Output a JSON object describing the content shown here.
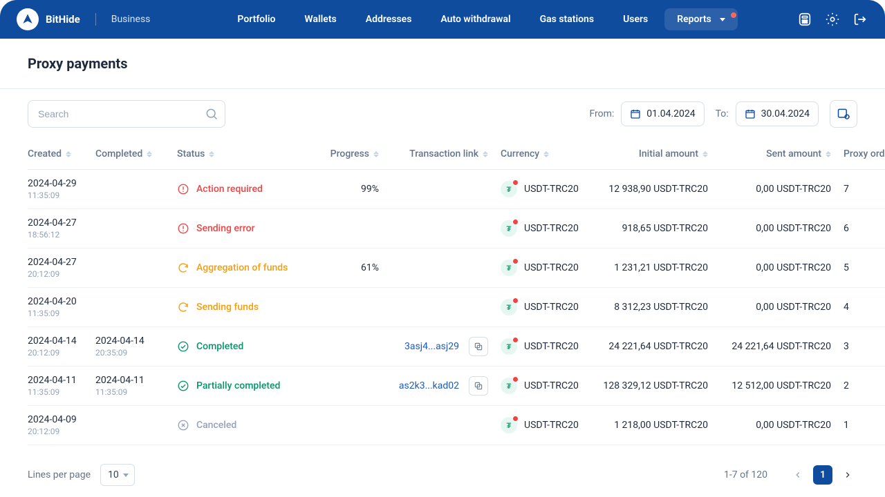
{
  "brand": {
    "name": "BitHide",
    "sub": "Business"
  },
  "nav": {
    "items": [
      "Portfolio",
      "Wallets",
      "Addresses",
      "Auto withdrawal",
      "Gas stations",
      "Users",
      "Reports"
    ],
    "active_index": 6
  },
  "page": {
    "title": "Proxy payments"
  },
  "toolbar": {
    "search_placeholder": "Search",
    "from_label": "From:",
    "to_label": "To:",
    "from_date": "01.04.2024",
    "to_date": "30.04.2024"
  },
  "columns": {
    "created": "Created",
    "completed": "Completed",
    "status": "Status",
    "progress": "Progress",
    "txlink": "Transaction link",
    "currency": "Currency",
    "initial": "Initial amount",
    "sent": "Sent amount",
    "proxy": "Proxy order"
  },
  "rows": [
    {
      "created_date": "2024-04-29",
      "created_time": "11:35:09",
      "completed_date": "",
      "completed_time": "",
      "status": "Action required",
      "status_kind": "red",
      "status_icon": "alert",
      "progress": "99%",
      "txlink": "",
      "currency": "USDT-TRC20",
      "initial": "12 938,90 USDT-TRC20",
      "sent": "0,00 USDT-TRC20",
      "proxy": "7"
    },
    {
      "created_date": "2024-04-27",
      "created_time": "18:56:12",
      "completed_date": "",
      "completed_time": "",
      "status": "Sending error",
      "status_kind": "red",
      "status_icon": "alert",
      "progress": "",
      "txlink": "",
      "currency": "USDT-TRC20",
      "initial": "918,65 USDT-TRC20",
      "sent": "0,00 USDT-TRC20",
      "proxy": "6"
    },
    {
      "created_date": "2024-04-27",
      "created_time": "20:12:09",
      "completed_date": "",
      "completed_time": "",
      "status": "Aggregation of funds",
      "status_kind": "orange",
      "status_icon": "refresh",
      "progress": "61%",
      "txlink": "",
      "currency": "USDT-TRC20",
      "initial": "1 231,21 USDT-TRC20",
      "sent": "0,00 USDT-TRC20",
      "proxy": "5"
    },
    {
      "created_date": "2024-04-20",
      "created_time": "11:35:09",
      "completed_date": "",
      "completed_time": "",
      "status": "Sending funds",
      "status_kind": "orange",
      "status_icon": "refresh",
      "progress": "",
      "txlink": "",
      "currency": "USDT-TRC20",
      "initial": "8 312,23 USDT-TRC20",
      "sent": "0,00 USDT-TRC20",
      "proxy": "4"
    },
    {
      "created_date": "2024-04-14",
      "created_time": "20:12:09",
      "completed_date": "2024-04-14",
      "completed_time": "20:35:09",
      "status": "Completed",
      "status_kind": "green",
      "status_icon": "check",
      "progress": "",
      "txlink": "3asj4...asj29",
      "currency": "USDT-TRC20",
      "initial": "24 221,64 USDT-TRC20",
      "sent": "24 221,64 USDT-TRC20",
      "proxy": "3"
    },
    {
      "created_date": "2024-04-11",
      "created_time": "11:35:09",
      "completed_date": "2024-04-11",
      "completed_time": "11:35:09",
      "status": "Partially completed",
      "status_kind": "green",
      "status_icon": "check",
      "progress": "",
      "txlink": "as2k3...kad02",
      "currency": "USDT-TRC20",
      "initial": "128 329,12 USDT-TRC20",
      "sent": "12 512,00 USDT-TRC20",
      "proxy": "2"
    },
    {
      "created_date": "2024-04-09",
      "created_time": "20:12:09",
      "completed_date": "",
      "completed_time": "",
      "status": "Canceled",
      "status_kind": "gray",
      "status_icon": "cancel",
      "progress": "",
      "txlink": "",
      "currency": "USDT-TRC20",
      "initial": "1 218,00 USDT-TRC20",
      "sent": "0,00 USDT-TRC20",
      "proxy": "1"
    }
  ],
  "footer": {
    "lines_per_page_label": "Lines per page",
    "lines_per_page_value": "10",
    "range": "1-7 of 120",
    "current_page": "1"
  }
}
